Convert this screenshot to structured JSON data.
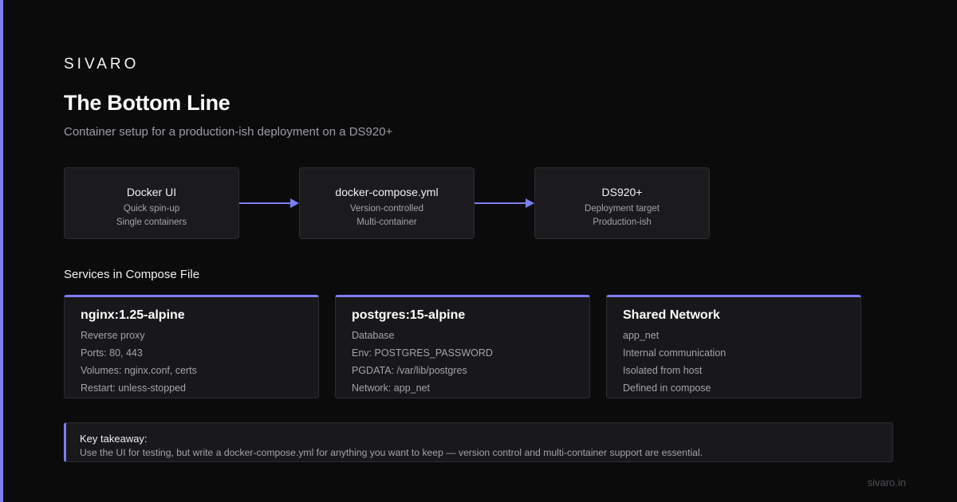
{
  "brand": "SIVARO",
  "title": "The Bottom Line",
  "subtitle": "Container setup for a production-ish deployment on a DS920+",
  "accent_color": "#7b7ff0",
  "flow": [
    {
      "title": "Docker UI",
      "lines": [
        "Quick spin-up",
        "Single containers"
      ]
    },
    {
      "title": "docker-compose.yml",
      "lines": [
        "Version-controlled",
        "Multi-container"
      ]
    },
    {
      "title": "DS920+",
      "lines": [
        "Deployment target",
        "Production-ish"
      ]
    }
  ],
  "services_heading": "Services in Compose File",
  "services": [
    {
      "title": "nginx:1.25-alpine",
      "lines": [
        "Reverse proxy",
        "Ports: 80, 443",
        "Volumes: nginx.conf, certs",
        "Restart: unless-stopped"
      ]
    },
    {
      "title": "postgres:15-alpine",
      "lines": [
        "Database",
        "Env: POSTGRES_PASSWORD",
        "PGDATA: /var/lib/postgres",
        "Network: app_net"
      ]
    },
    {
      "title": "Shared Network",
      "lines": [
        "app_net",
        "Internal communication",
        "Isolated from host",
        "Defined in compose"
      ]
    }
  ],
  "takeaway": {
    "label": "Key takeaway:",
    "text": "Use the UI for testing, but write a docker-compose.yml for anything you want to keep — version control and multi-container support are essential."
  },
  "footer": "sivaro.in"
}
